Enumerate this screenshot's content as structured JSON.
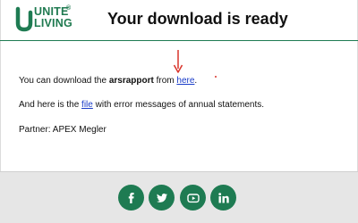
{
  "brand": {
    "logo_line1": "UNITE",
    "logo_line2": "LIVING",
    "registered_mark": "®",
    "color": "#1e7b52"
  },
  "header": {
    "title": "Your download is ready"
  },
  "body": {
    "line1_before": "You can download the ",
    "line1_bold": "arsrapport",
    "line1_middle": " from ",
    "line1_link": "here",
    "line1_after": ".",
    "line2_before": "And here is the ",
    "line2_link": "file",
    "line2_after": " with error messages of annual statements.",
    "line3": "Partner: APEX Megler"
  },
  "annotation": {
    "arrow_color": "#d9342b"
  },
  "footer": {
    "social_icons": [
      "facebook-icon",
      "twitter-icon",
      "youtube-icon",
      "linkedin-icon"
    ],
    "background": "#e6e6e6"
  }
}
